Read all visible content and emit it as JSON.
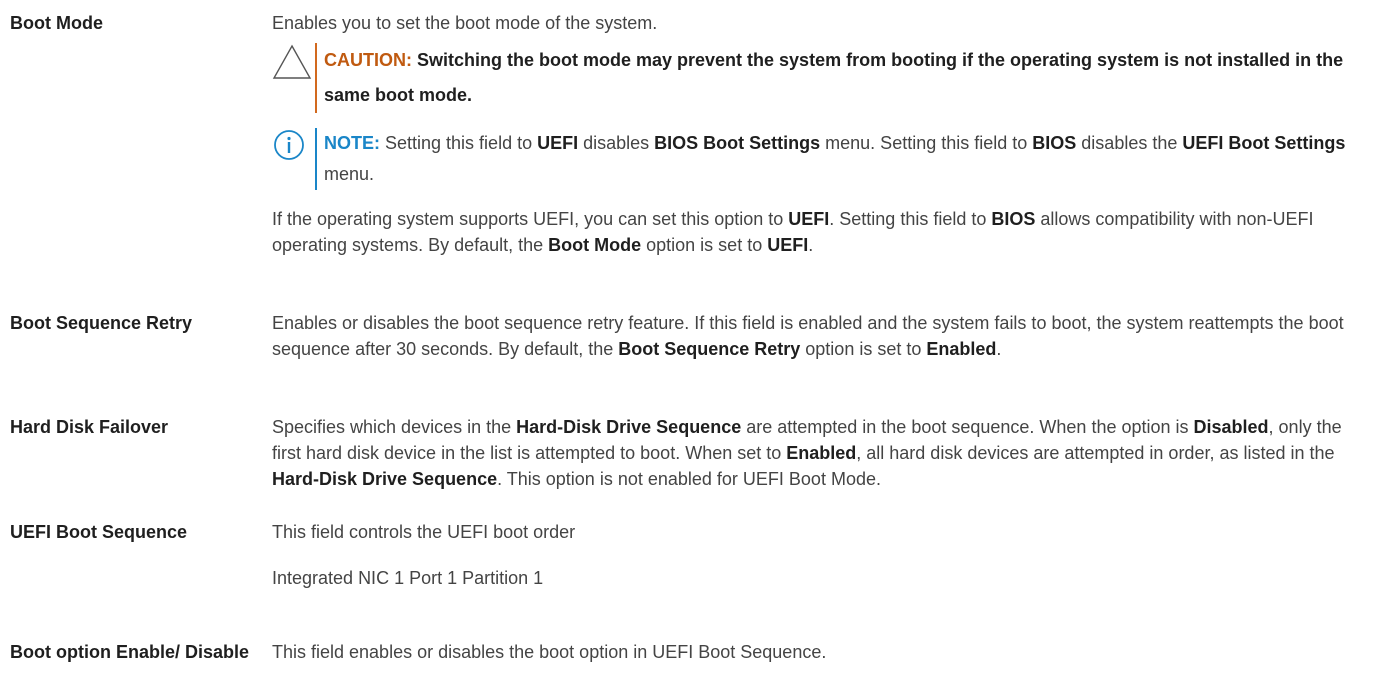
{
  "rows": [
    {
      "term": "Boot Mode",
      "intro": "Enables you to set the boot mode of the system.",
      "caution": {
        "lead": "CAUTION:",
        "text": " Switching the boot mode may prevent the system from booting if the operating system is not installed in the same boot mode."
      },
      "note": {
        "lead": "NOTE:",
        "t1": " Setting this field to ",
        "b1": "UEFI",
        "t2": " disables ",
        "b2": "BIOS Boot Settings",
        "t3": " menu. Setting this field to ",
        "b3": "BIOS",
        "t4": " disables the ",
        "b4": "UEFI Boot Settings",
        "t5": " menu."
      },
      "desc": {
        "t1": "If the operating system supports UEFI, you can set this option to ",
        "b1": "UEFI",
        "t2": ". Setting this field to ",
        "b2": "BIOS",
        "t3": " allows compatibility with non-UEFI operating systems. By default, the ",
        "b3": "Boot Mode",
        "t4": " option is set to ",
        "b4": "UEFI",
        "t5": "."
      }
    },
    {
      "term": "Boot Sequence Retry",
      "desc": {
        "t1": "Enables or disables the boot sequence retry feature. If this field is enabled and the system fails to boot, the system reattempts the boot sequence after 30 seconds. By default, the ",
        "b1": "Boot Sequence Retry",
        "t2": " option is set to ",
        "b2": "Enabled",
        "t3": "."
      }
    },
    {
      "term": "Hard Disk Failover",
      "desc": {
        "t1": "Specifies which devices in the ",
        "b1": "Hard-Disk Drive Sequence",
        "t2": " are attempted in the boot sequence. When the option is ",
        "b2": "Disabled",
        "t3": ", only the first hard disk device in the list is attempted to boot. When set to ",
        "b3": "Enabled",
        "t4": ", all hard disk devices are attempted in order, as listed in the ",
        "b4": "Hard-Disk Drive Sequence",
        "t5": ". This option is not enabled for UEFI Boot Mode."
      }
    },
    {
      "term": "UEFI Boot Sequence",
      "line1": "This field controls the UEFI boot order",
      "line2": "Integrated NIC 1 Port 1 Partition 1"
    },
    {
      "term": "Boot option Enable/ Disable",
      "desc": "This field enables or disables the boot option in UEFI Boot Sequence."
    }
  ],
  "icons": {
    "caution": "caution-triangle-icon",
    "note": "info-circle-icon"
  },
  "colors": {
    "caution_accent": "#d2691e",
    "note_accent": "#1a86c8"
  }
}
